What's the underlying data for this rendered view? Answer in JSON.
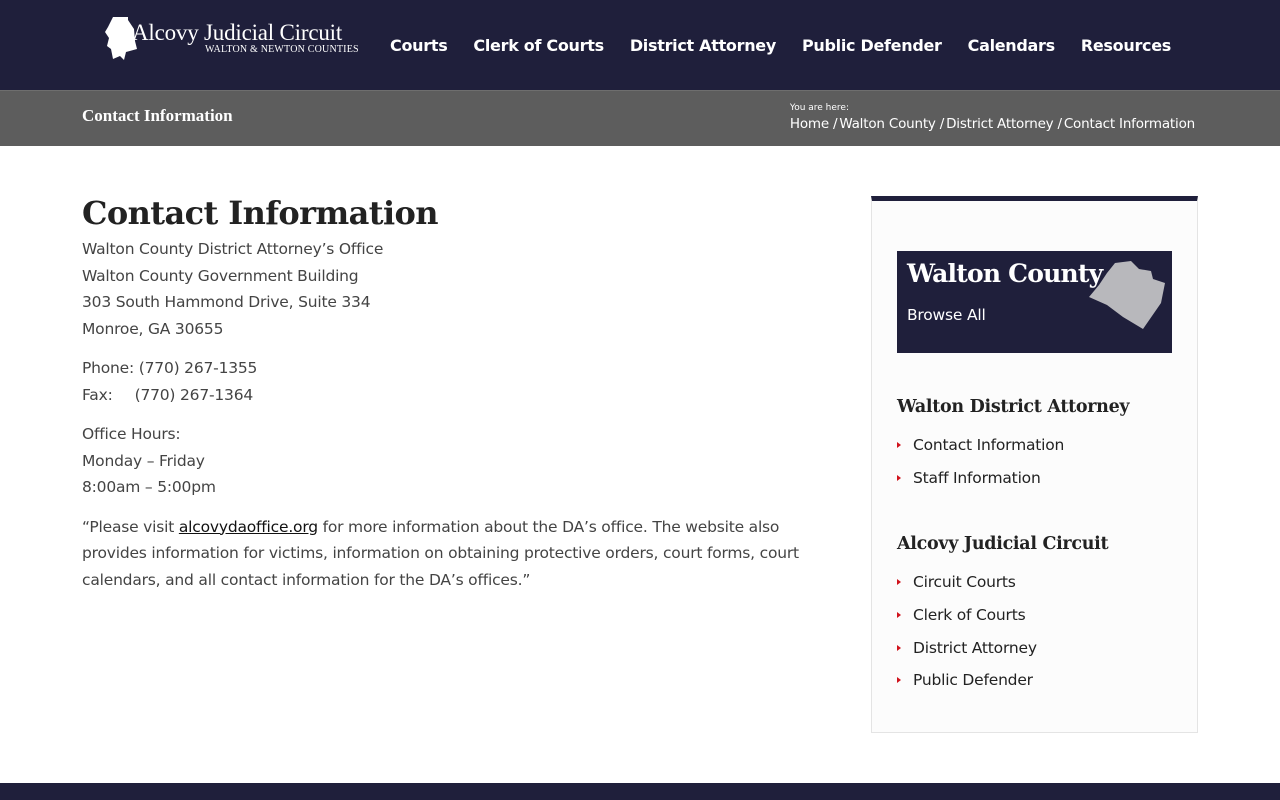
{
  "colors": {
    "header_bg": "#1f1f3b",
    "title_bar_bg": "#5d5d5d",
    "accent_bullet": "#d0131c",
    "card_bg": "#1f1f3b",
    "map_fill": "#b8b8bc"
  },
  "header": {
    "logo": {
      "title": "Alcovy Judicial Circuit",
      "subtitle": "WALTON & NEWTON COUNTIES",
      "icon": "state-map-icon"
    },
    "nav": [
      {
        "label": "Courts"
      },
      {
        "label": "Clerk of Courts"
      },
      {
        "label": "District Attorney"
      },
      {
        "label": "Public Defender"
      },
      {
        "label": "Calendars"
      },
      {
        "label": "Resources"
      }
    ],
    "search_icon": "search-icon"
  },
  "title_bar": {
    "heading": "Contact Information",
    "breadcrumb_label": "You are here:",
    "breadcrumb": [
      {
        "label": "Home"
      },
      {
        "label": "Walton County"
      },
      {
        "label": "District Attorney"
      },
      {
        "label": "Contact Information"
      }
    ],
    "separator": "/"
  },
  "content": {
    "title": "Contact Information",
    "address": [
      "Walton County District Attorney’s Office",
      "Walton County Government Building",
      "303 South Hammond Drive, Suite 334",
      "Monroe, GA 30655"
    ],
    "phone_label": "Phone:",
    "phone": "(770) 267-1355",
    "fax_label": "Fax:",
    "fax": "(770) 267-1364",
    "hours_label": "Office Hours:",
    "hours_days": "Monday – Friday",
    "hours_time": "8:00am – 5:00pm",
    "note_before": "“Please visit ",
    "note_link": "alcovydaoffice.org",
    "note_after": " for more information about the DA’s office. The website also provides information for victims, information on obtaining protective orders, court forms, court calendars, and all contact information for the DA’s offices.”"
  },
  "sidebar": {
    "county_card": {
      "title": "Walton County",
      "subtitle": "Browse All",
      "icon": "county-map-icon"
    },
    "widgets": [
      {
        "title": "Walton District Attorney",
        "links": [
          {
            "label": "Contact Information"
          },
          {
            "label": "Staff Information"
          }
        ]
      },
      {
        "title": "Alcovy Judicial Circuit",
        "links": [
          {
            "label": "Circuit Courts"
          },
          {
            "label": "Clerk of Courts"
          },
          {
            "label": "District Attorney"
          },
          {
            "label": "Public Defender"
          }
        ]
      }
    ]
  }
}
